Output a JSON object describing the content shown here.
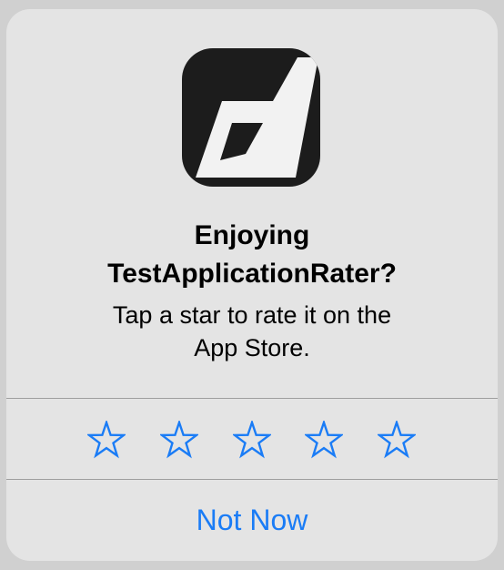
{
  "dialog": {
    "title": "Enjoying TestApplicationRater?",
    "title_lines": [
      "Enjoying",
      "TestApplicationRater?"
    ],
    "message_lines": [
      "Tap a star to rate it on the",
      "App Store."
    ],
    "app_icon": "app-logo-icon",
    "stars": [
      {
        "icon": "star-outline-icon",
        "value": 1
      },
      {
        "icon": "star-outline-icon",
        "value": 2
      },
      {
        "icon": "star-outline-icon",
        "value": 3
      },
      {
        "icon": "star-outline-icon",
        "value": 4
      },
      {
        "icon": "star-outline-icon",
        "value": 5
      }
    ],
    "rating": 0,
    "not_now_label": "Not Now"
  },
  "colors": {
    "accent": "#1a7cf6",
    "alert_background": "#e4e4e4",
    "icon_background": "#1c1c1c",
    "divider": "#9e9e9e"
  }
}
